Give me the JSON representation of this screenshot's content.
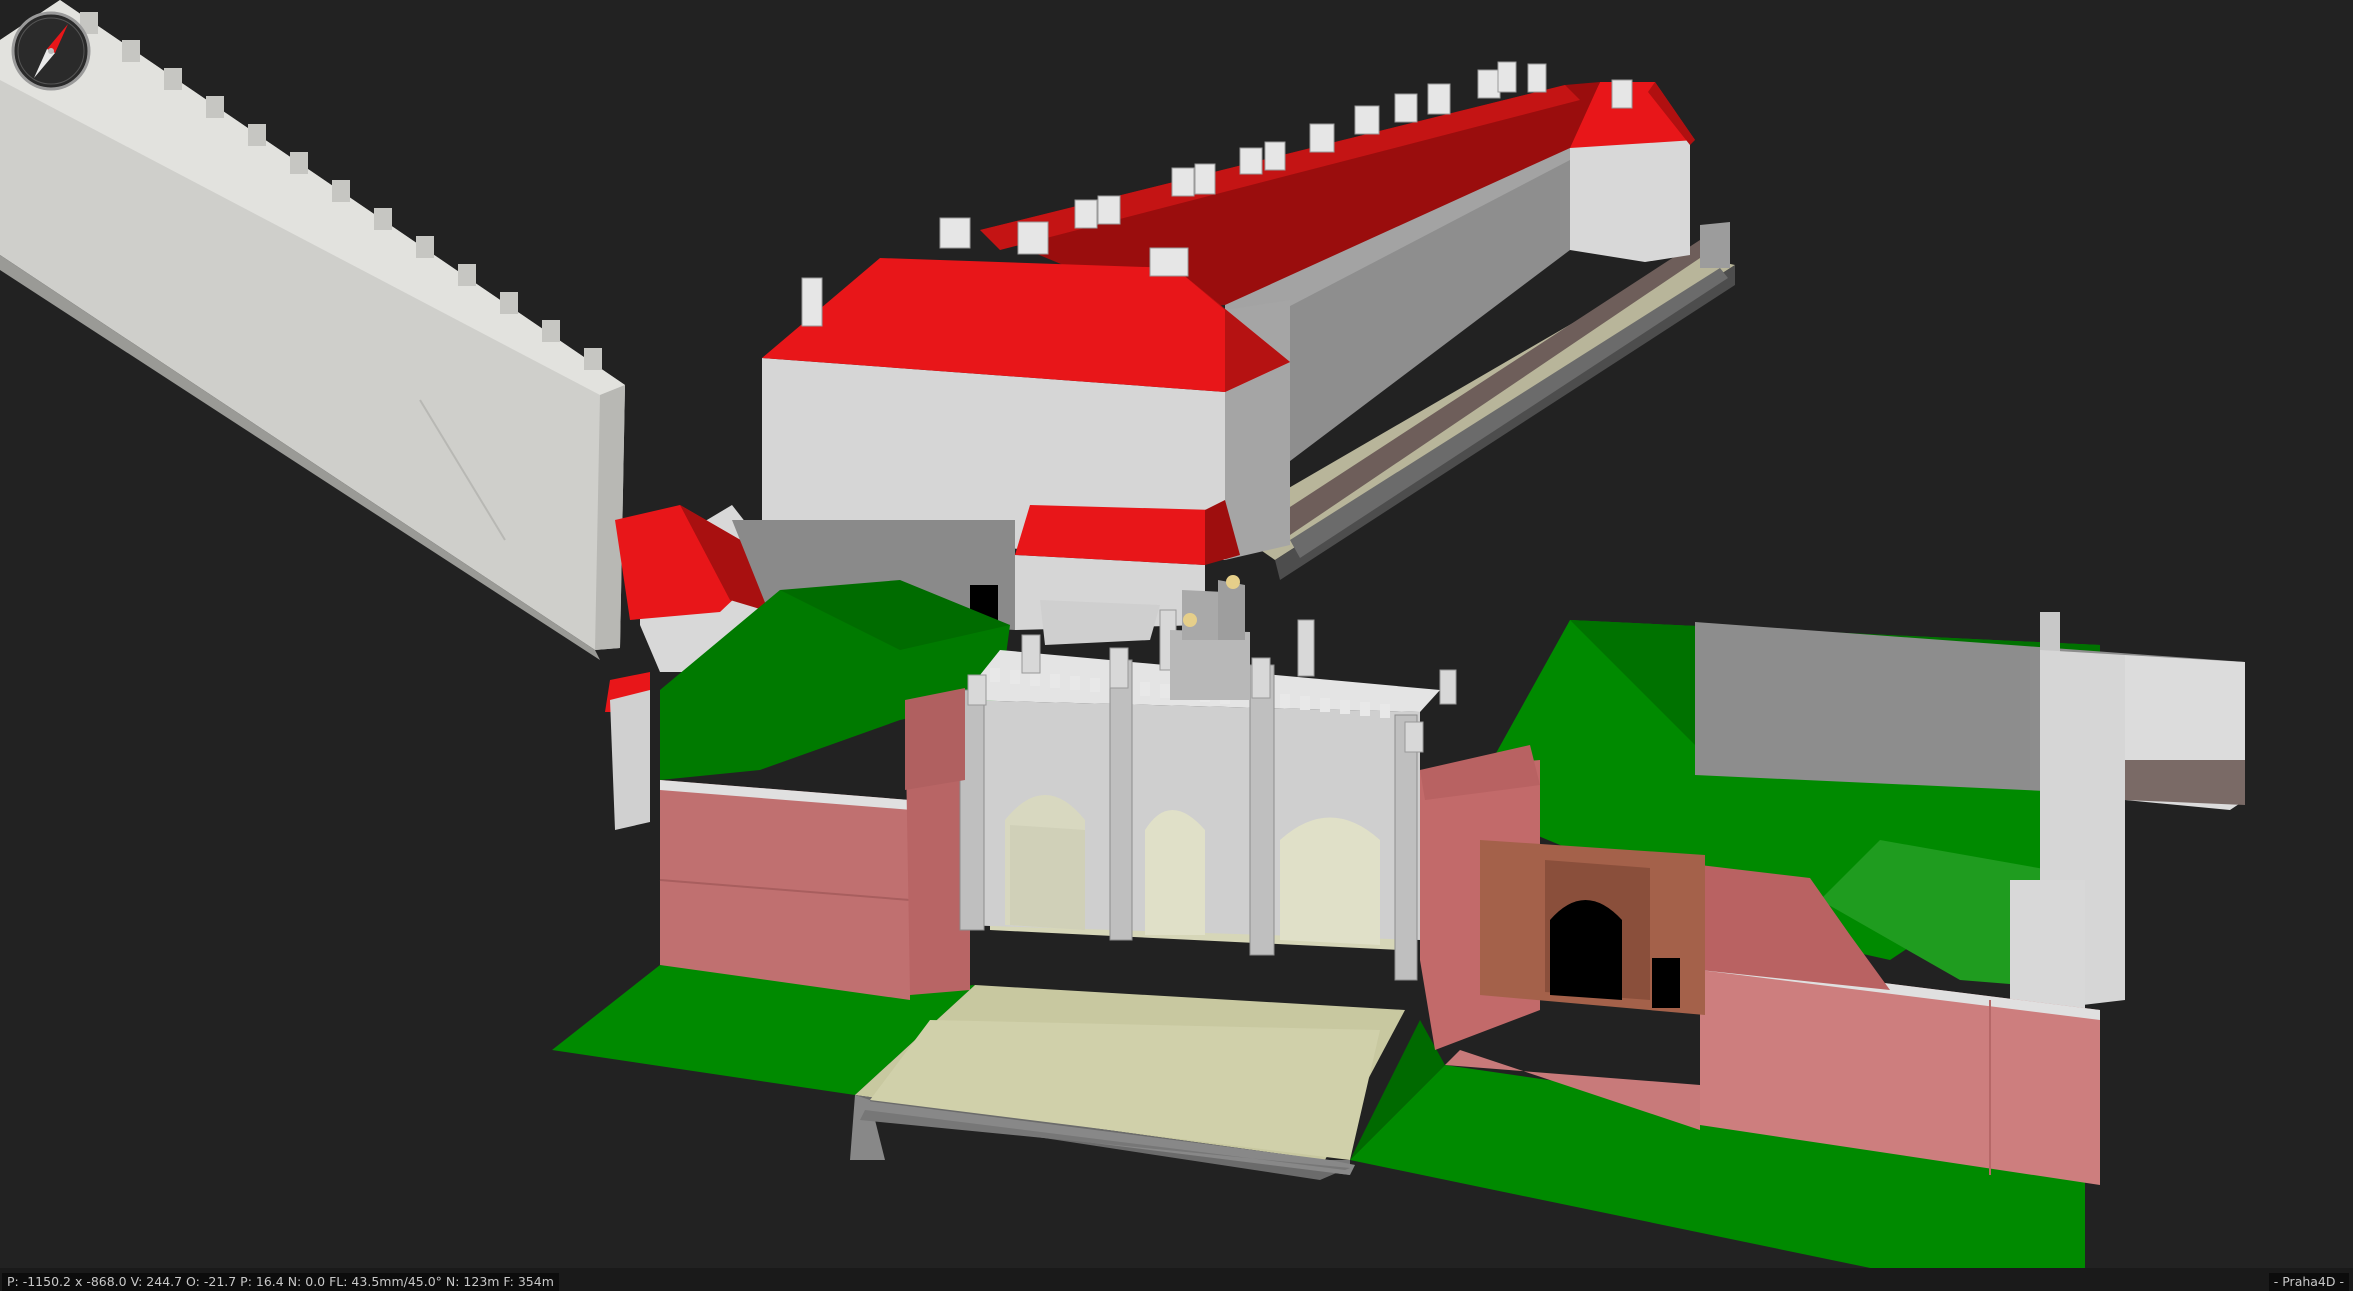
{
  "viewer": {
    "status_readout": "P: -1150.2 x -868.0  V: 244.7  O: -21.7  P: 16.4  N: 0.0  FL: 43.5mm/45.0°  N: 123m  F: 354m",
    "app_name": "- Praha4D -"
  },
  "scene": {
    "background_color": "#222222",
    "roof_color": "#e8161a",
    "wall_color": "#d4d4d4",
    "lawn_color": "#008a00",
    "rampart_color": "#c07070"
  },
  "icons": {
    "compass": "compass-icon"
  }
}
